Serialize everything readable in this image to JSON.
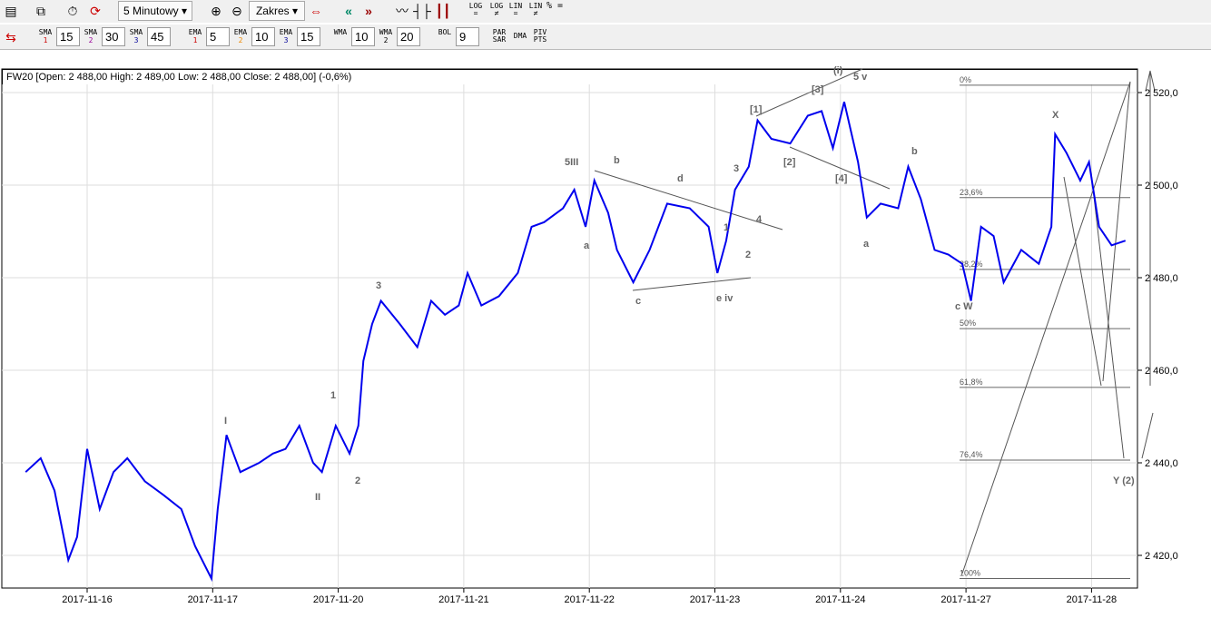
{
  "toolbar1": {
    "interval": "5 Minutowy",
    "range": "Zakres",
    "scale_buttons": [
      "LOG =",
      "LOG ≠",
      "LIN =",
      "LIN ≠",
      "% ="
    ]
  },
  "toolbar2": {
    "indicators": [
      {
        "label": "SMA",
        "sub": "1",
        "value": "15"
      },
      {
        "label": "SMA",
        "sub": "2",
        "value": "30"
      },
      {
        "label": "SMA",
        "sub": "3",
        "value": "45"
      },
      {
        "label": "EMA",
        "sub": "1",
        "value": "5"
      },
      {
        "label": "EMA",
        "sub": "2",
        "value": "10"
      },
      {
        "label": "EMA",
        "sub": "3",
        "value": "15"
      },
      {
        "label": "WMA",
        "sub": "",
        "value": "10"
      },
      {
        "label": "WMA",
        "sub": "2",
        "value": "20"
      },
      {
        "label": "BOL",
        "sub": "",
        "value": "9"
      }
    ],
    "extra": [
      "PAR SAR",
      "DMA",
      "PIV PTS"
    ]
  },
  "header": "FW20 [Open: 2 488,00  High: 2 489,00  Low: 2 488,00  Close: 2 488,00] (-0,6%)",
  "colors": {
    "series": "#0000ee",
    "grid": "#dddddd",
    "annotation": "#666666"
  },
  "chart_data": {
    "type": "line",
    "title": "FW20",
    "xlabel": "",
    "ylabel": "",
    "x_ticks": [
      "2017-11-16",
      "2017-11-17",
      "2017-11-20",
      "2017-11-21",
      "2017-11-22",
      "2017-11-23",
      "2017-11-24",
      "2017-11-27",
      "2017-11-28"
    ],
    "y_ticks": [
      "2 420,0",
      "2 440,0",
      "2 460,0",
      "2 480,0",
      "2 500,0",
      "2 520,0"
    ],
    "y_tick_values": [
      2420,
      2440,
      2460,
      2480,
      2500,
      2520
    ],
    "ylim": [
      2413,
      2527
    ],
    "x_unit": "trading days offset from 2017-11-16",
    "grid": true,
    "series": [
      {
        "name": "FW20 5min",
        "x": [
          -0.49,
          -0.37,
          -0.26,
          -0.15,
          -0.08,
          0,
          0.1,
          0.21,
          0.32,
          0.46,
          0.61,
          0.75,
          0.86,
          0.99,
          1.04,
          1.11,
          1.22,
          1.37,
          1.48,
          1.58,
          1.69,
          1.8,
          1.87,
          1.98,
          2.09,
          2.16,
          2.2,
          2.27,
          2.34,
          2.49,
          2.63,
          2.74,
          2.85,
          2.96,
          3.03,
          3.14,
          3.28,
          3.43,
          3.54,
          3.64,
          3.79,
          3.88,
          3.97,
          4.04,
          4.15,
          4.22,
          4.35,
          4.48,
          4.62,
          4.8,
          4.95,
          5.02,
          5.09,
          5.16,
          5.27,
          5.34,
          5.45,
          5.6,
          5.74,
          5.85,
          5.94,
          6.03,
          6.14,
          6.21,
          6.32,
          6.46,
          6.54,
          6.64,
          6.75,
          6.86,
          6.97,
          7.04,
          7.12,
          7.22,
          7.3,
          7.44,
          7.58,
          7.68,
          7.71,
          7.8,
          7.91,
          7.98,
          8.06,
          8.16,
          8.27
        ],
        "values": [
          2438,
          2441,
          2434,
          2419,
          2424,
          2443,
          2430,
          2438,
          2441,
          2436,
          2433,
          2430,
          2422,
          2415,
          2430,
          2446,
          2438,
          2440,
          2442,
          2443,
          2448,
          2440,
          2438,
          2448,
          2442,
          2448,
          2462,
          2470,
          2475,
          2470,
          2465,
          2475,
          2472,
          2474,
          2481,
          2474,
          2476,
          2481,
          2491,
          2492,
          2495,
          2499,
          2491,
          2501,
          2494,
          2486,
          2479,
          2486,
          2496,
          2495,
          2491,
          2481,
          2488,
          2499,
          2504,
          2514,
          2510,
          2509,
          2515,
          2516,
          2508,
          2518,
          2505,
          2493,
          2496,
          2495,
          2504,
          2497,
          2486,
          2485,
          2483,
          2475,
          2491,
          2489,
          2479,
          2486,
          2483,
          2491,
          2511,
          2507,
          2501,
          2505,
          2491,
          2487,
          2488
        ]
      }
    ],
    "fibonacci": [
      {
        "label": "0%",
        "value": 2521.6
      },
      {
        "label": "23,6%",
        "value": 2497.3
      },
      {
        "label": "38,2%",
        "value": 2481.8
      },
      {
        "label": "50%",
        "value": 2469
      },
      {
        "label": "61,8%",
        "value": 2456.3
      },
      {
        "label": "76,4%",
        "value": 2440.6
      },
      {
        "label": "100%",
        "value": 2415
      }
    ],
    "annotations": [
      "I",
      "II",
      "1",
      "2",
      "3",
      "5III",
      "a",
      "b",
      "c",
      "d",
      "4",
      "2",
      "e iv",
      "1",
      "3",
      "[1]",
      "[2]",
      "[3]",
      "[4]",
      "5 v",
      "(i)",
      "b",
      "a",
      "c W",
      "X",
      "Y (2)"
    ]
  }
}
